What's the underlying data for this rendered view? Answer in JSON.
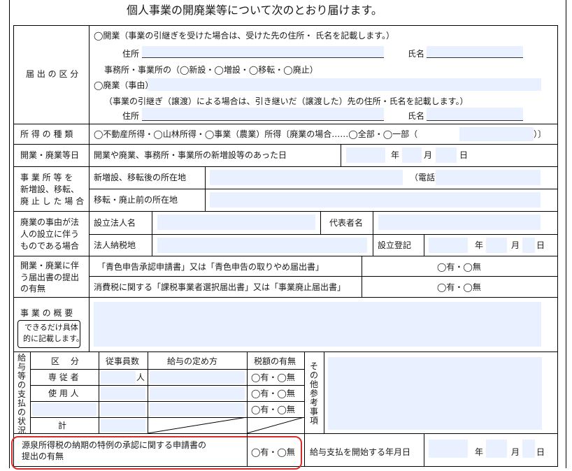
{
  "title": "個人事業の開廃業等について次のとおり届けます。",
  "notify": {
    "label": "届 出 の 区 分",
    "open_line": "◯開業（事業の引継ぎを受けた場合は、受けた先の住所・ 氏名を記載します。）",
    "address": "住所",
    "name": "氏名",
    "office_line": "事務所・事業所の（◯新設・◯増設・◯移転・◯廃止）",
    "close_line": "◯廃業（事由）",
    "succession_line": "（事業の引継ぎ（譲渡）による場合は、引き継いだ（譲渡した）先の住所・氏名を記載します。）",
    "address2": "住所",
    "name2": "氏名"
  },
  "income": {
    "label": "所 得 の 種 類",
    "value": "◯不動産所得・◯山林所得・◯事業（農業）所得〔廃業の場合……◯全部・◯一部（",
    "close": "）〕"
  },
  "dates": {
    "label": "開業・廃業等日",
    "text": "開業や廃業、事務所・事業所の新増設等のあった日",
    "year": "年",
    "month": "月",
    "day": "日"
  },
  "office": {
    "label": [
      "事 業 所 等 を",
      "新増設、移転、",
      "廃 止 し た 場 合"
    ],
    "new_label": "新増設、移転後の所在地",
    "phone": "（電話）",
    "old_label": "移転・廃止前の所在地"
  },
  "corp": {
    "label": [
      "廃業の事由が法",
      "人の設立に伴う",
      "ものである場合"
    ],
    "name_label": "設立法人名",
    "rep_label": "代表者名",
    "tax_label": "法人納税地",
    "reg_label": "設立登記",
    "year": "年",
    "month": "月",
    "day": "日"
  },
  "filings": {
    "label": [
      "開業・廃業に伴",
      "う届出書の提出",
      "の有無"
    ],
    "blue": "「青色申告承認申請書」又は「青色申告の取りやめ届出書」",
    "consumption": "消費税に関する「課税事業者選択届出書」又は「事業廃止届出書」",
    "yesno": "◯有・◯無"
  },
  "summary": {
    "label": "事 業 の 概 要",
    "note1": "できるだけ具体",
    "note2": "的に記載します。"
  },
  "payroll": {
    "side_label": "給与等の支払の状況",
    "h_kubun": "区　 分",
    "h_count": "従事員数",
    "h_method": "給与の定め方",
    "h_tax": "税額の有無",
    "row1": "専 従 者",
    "row2": "使 用 人",
    "person": "人",
    "total": "計",
    "yesno": "◯有・◯無",
    "other": "その他参考事項"
  },
  "withholding": {
    "label1": "源泉所得税の納期の特例の承認に関する申請書の",
    "label2": "提出の有無",
    "yesno": "◯有・◯無",
    "start_label": "給与支払を開始する年月日",
    "year": "年",
    "month": "月",
    "day": "日"
  },
  "colors": {
    "fill": "#e9f0ff",
    "highlight": "#d92b2b"
  }
}
